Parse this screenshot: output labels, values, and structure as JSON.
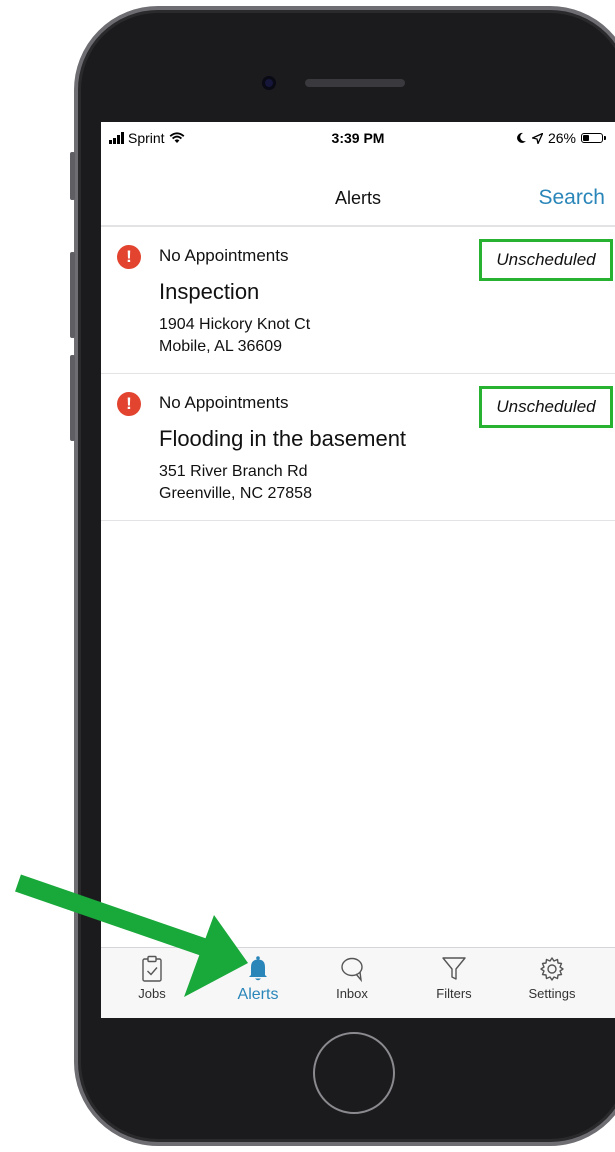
{
  "status_bar": {
    "carrier": "Sprint",
    "time": "3:39 PM",
    "battery": "26%"
  },
  "nav": {
    "title": "Alerts",
    "search_label": "Search"
  },
  "alerts": [
    {
      "status": "No Appointments",
      "title": "Inspection",
      "address_line1": "1904 Hickory Knot Ct",
      "address_line2": "Mobile, AL 36609",
      "badge": "Unscheduled"
    },
    {
      "status": "No Appointments",
      "title": "Flooding in the basement",
      "address_line1": "351 River Branch Rd",
      "address_line2": "Greenville, NC 27858",
      "badge": "Unscheduled"
    }
  ],
  "tabs": [
    {
      "label": "Jobs",
      "icon": "clipboard-check-icon"
    },
    {
      "label": "Alerts",
      "icon": "bell-icon",
      "active": true
    },
    {
      "label": "Inbox",
      "icon": "chat-bubble-icon"
    },
    {
      "label": "Filters",
      "icon": "funnel-icon"
    },
    {
      "label": "Settings",
      "icon": "gear-icon"
    }
  ],
  "colors": {
    "accent": "#2a86b9",
    "alert": "#e2442f",
    "highlight": "#27b232",
    "annotation_arrow": "#19a83a"
  }
}
